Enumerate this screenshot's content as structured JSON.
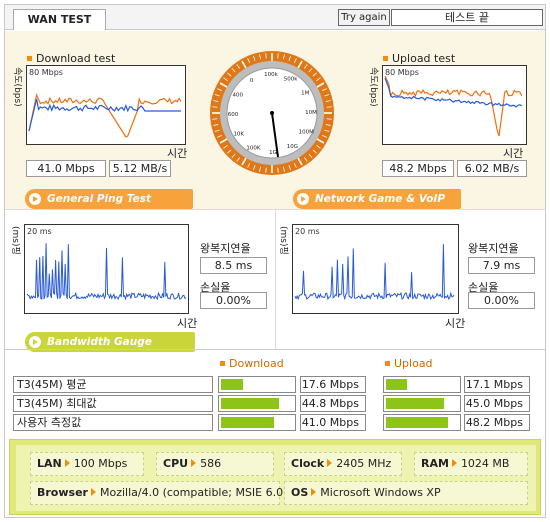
{
  "header": {
    "title": "WAN TEST",
    "try_again": "Try again",
    "status": "테스트 끝"
  },
  "download": {
    "label": "Download test",
    "ylabel": "속도(bps)",
    "scale": "80 Mbps",
    "xlabel": "시간",
    "mbps": "41.0 Mbps",
    "mbs": "5.12 MB/s"
  },
  "upload": {
    "label": "Upload test",
    "ylabel": "속도(bps)",
    "scale": "80 Mbps",
    "xlabel": "시간",
    "mbps": "48.2 Mbps",
    "mbs": "6.02 MB/s"
  },
  "gauge": {
    "ticks": [
      "0",
      "100k",
      "500k",
      "1M",
      "10M",
      "100M",
      "10G",
      "1G",
      "100K",
      "10K",
      "600",
      "400"
    ]
  },
  "ping_tab": "General Ping Test",
  "game_tab": "Network Game & VoIP Test",
  "ping": {
    "ylabel": "(ms)핑",
    "scale": "20 ms",
    "xlabel": "시간",
    "rtt_label": "왕복지연율",
    "rtt": "8.5 ms",
    "loss_label": "손실율",
    "loss": "0.00%"
  },
  "game": {
    "ylabel": "(ms)핑",
    "scale": "20 ms",
    "xlabel": "시간",
    "rtt_label": "왕복지연율",
    "rtt": "7.9 ms",
    "loss_label": "손실율",
    "loss": "0.00%"
  },
  "bandwidth_tab": "Bandwidth Gauge",
  "bandwidth": {
    "download_head": "Download",
    "upload_head": "Upload",
    "rows": [
      {
        "label": "T3(45M) 평균",
        "down": "17.6 Mbps",
        "down_frac": 0.3,
        "up": "17.1 Mbps",
        "up_frac": 0.29
      },
      {
        "label": "T3(45M) 최대값",
        "down": "44.8 Mbps",
        "down_frac": 0.78,
        "up": "45.0 Mbps",
        "up_frac": 0.78
      },
      {
        "label": "사용자 측정값",
        "down": "41.0 Mbps",
        "down_frac": 0.71,
        "up": "48.2 Mbps",
        "up_frac": 0.84
      }
    ]
  },
  "system": {
    "lan_label": "LAN",
    "lan": "100 Mbps",
    "cpu_label": "CPU",
    "cpu": "586",
    "clock_label": "Clock",
    "clock": "2405 MHz",
    "ram_label": "RAM",
    "ram": "1024 MB",
    "browser_label": "Browser",
    "browser": "Mozilla/4.0 (compatible; MSIE 6.0",
    "os_label": "OS",
    "os": "Microsoft Windows XP"
  },
  "colors": {
    "accent": "#f7a23a",
    "green": "#c9d53a",
    "bar": "#8cc41a",
    "line_blue": "#2a5bd7",
    "line_orange": "#f07010"
  }
}
